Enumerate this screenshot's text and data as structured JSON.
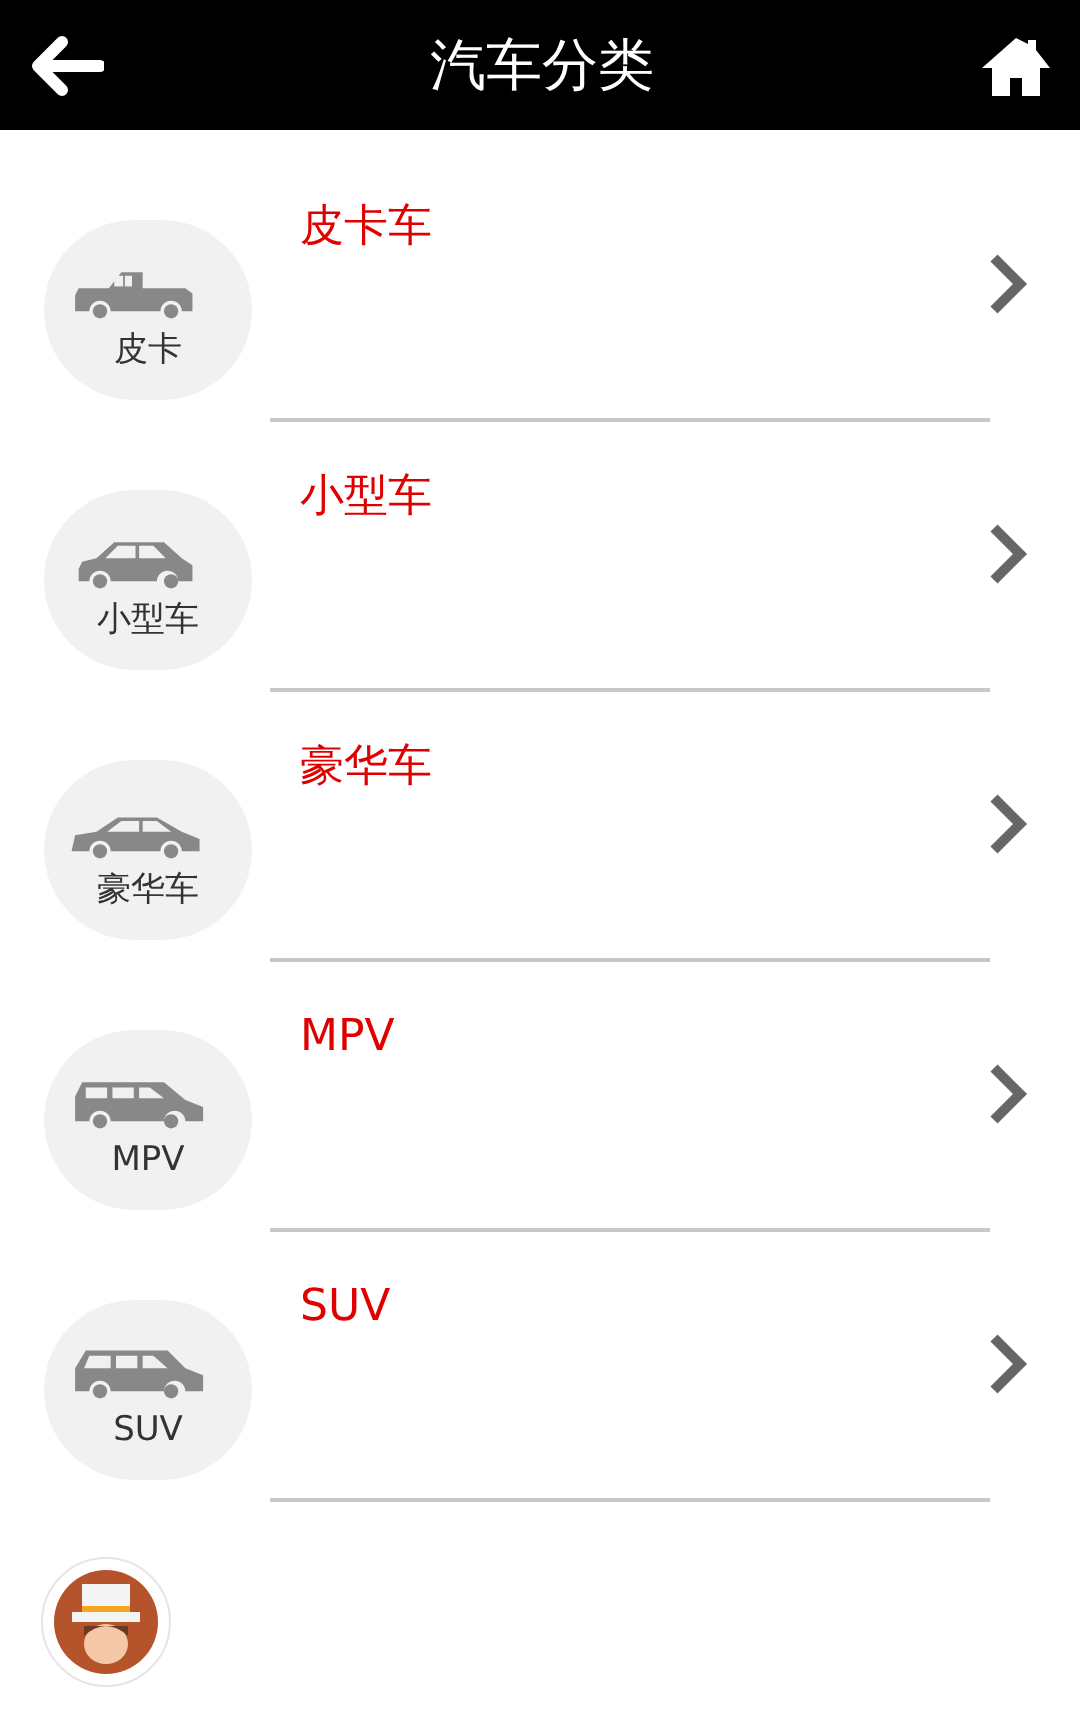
{
  "header": {
    "title": "汽车分类"
  },
  "categories": [
    {
      "kind": "pickup",
      "icon_label": "皮卡",
      "title": "皮卡车"
    },
    {
      "kind": "compact",
      "icon_label": "小型车",
      "title": "小型车"
    },
    {
      "kind": "sedan",
      "icon_label": "豪华车",
      "title": "豪华车"
    },
    {
      "kind": "mpv",
      "icon_label": "MPV",
      "title": "MPV"
    },
    {
      "kind": "suv",
      "icon_label": "SUV",
      "title": "SUV"
    }
  ]
}
